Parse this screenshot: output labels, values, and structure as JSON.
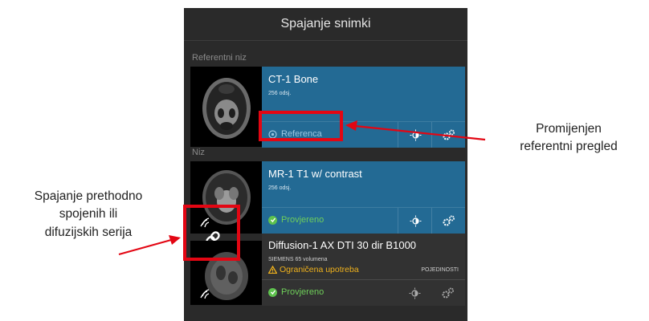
{
  "header": {
    "title": "Spajanje snimki"
  },
  "sections": {
    "reference": "Referentni niz",
    "series": "Niz"
  },
  "reference_card": {
    "title": "CT-1 Bone",
    "subtitle": "256 odsj.",
    "action": "Referenca"
  },
  "series_cards": [
    {
      "title": "MR-1 T1 w/ contrast",
      "subtitle": "256 odsj.",
      "status": "Provjereno"
    },
    {
      "title": "Diffusion-1 AX DTI 30 dir B1000",
      "subtitle": "SIEMENS 65 volumena",
      "warning": "Ograničena upotreba",
      "details": "POJEDINOSTI",
      "status": "Provjereno"
    }
  ],
  "callouts": {
    "right": [
      "Promijenjen",
      "referentni pregled"
    ],
    "left": [
      "Spajanje prethodno",
      "spojenih ili",
      "difuzijskih serija"
    ]
  },
  "colors": {
    "card": "#236a94",
    "panel": "#2a2a2a",
    "ok": "#5ec24e",
    "warning": "#f0b21c",
    "annotation": "#e30613"
  }
}
